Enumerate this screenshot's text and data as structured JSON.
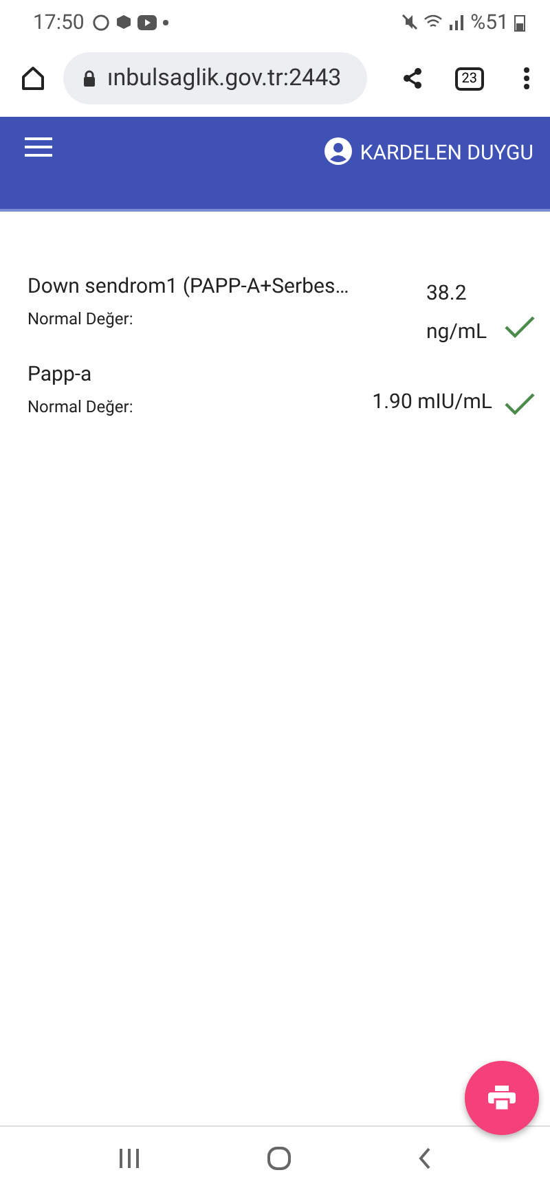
{
  "status_bar": {
    "time": "17:50",
    "battery": "%51"
  },
  "browser": {
    "url": "ınbulsaglik.gov.tr:2443",
    "tab_count": "23"
  },
  "header": {
    "user": "KARDELEN DUYGU"
  },
  "results": [
    {
      "name": "Down sendrom1 (PAPP-A+Serbes…",
      "label": "Normal Değer:",
      "value": "38.2 ng/mL",
      "ok": true
    },
    {
      "name": "Papp-a",
      "label": "Normal Değer:",
      "value": "1.90 mIU/mL",
      "ok": true
    }
  ]
}
